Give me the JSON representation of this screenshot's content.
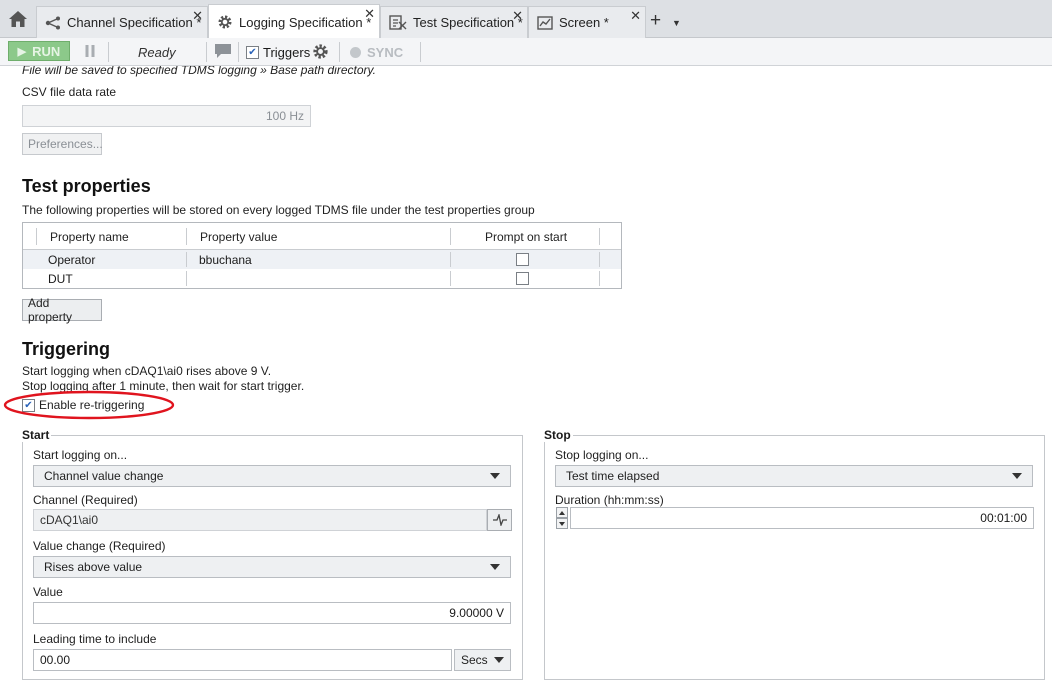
{
  "tabs": [
    {
      "label": "Channel Specification *",
      "icon": "channel-share-icon"
    },
    {
      "label": "Logging Specification *",
      "icon": "gear-icon"
    },
    {
      "label": "Test Specification *",
      "icon": "test-spec-icon"
    },
    {
      "label": "Screen *",
      "icon": "screen-chart-icon"
    }
  ],
  "toolbar": {
    "run_label": "RUN",
    "status": "Ready",
    "triggers_label": "Triggers",
    "triggers_checked": true,
    "sync_label": "SYNC"
  },
  "logging": {
    "note": "File will be saved to specified TDMS logging » Base path directory.",
    "csv_rate_label": "CSV file data rate",
    "csv_rate_value": "100 Hz",
    "preferences_label": "Preferences..."
  },
  "test_properties": {
    "heading": "Test properties",
    "description": "The following properties will be stored on every logged TDMS file under the test properties group",
    "columns": [
      "Property name",
      "Property value",
      "Prompt on start"
    ],
    "rows": [
      {
        "name": "Operator",
        "value": "bbuchana",
        "prompt": false
      },
      {
        "name": "DUT",
        "value": "",
        "prompt": false
      }
    ],
    "add_label": "Add property"
  },
  "triggering": {
    "heading": "Triggering",
    "line1": "Start logging when cDAQ1\\ai0 rises above 9 V.",
    "line2": "Stop logging after 1 minute, then wait for start trigger.",
    "retrigger_label": "Enable re-triggering",
    "retrigger_checked": true,
    "highlight_color": "#e0141e"
  },
  "start": {
    "title": "Start",
    "logging_on_label": "Start logging on...",
    "logging_on_value": "Channel value change",
    "channel_label": "Channel (Required)",
    "channel_value": "cDAQ1\\ai0",
    "value_change_label": "Value change (Required)",
    "value_change_value": "Rises above value",
    "value_label": "Value",
    "value_value": "9.00000 V",
    "leading_label": "Leading time to include",
    "leading_value": "00.00",
    "leading_unit": "Secs"
  },
  "stop": {
    "title": "Stop",
    "logging_on_label": "Stop logging on...",
    "logging_on_value": "Test time elapsed",
    "duration_label": "Duration (hh:mm:ss)",
    "duration_value": "00:01:00"
  }
}
